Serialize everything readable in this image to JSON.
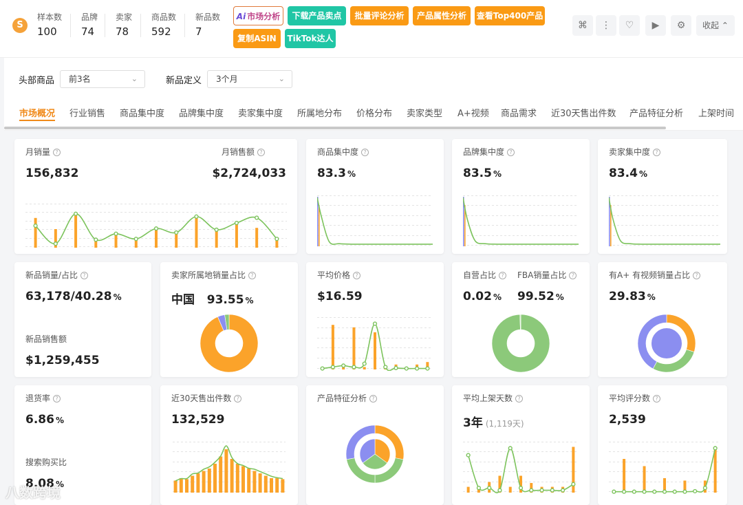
{
  "header": {
    "logo_glyph": "S",
    "stats": [
      {
        "label": "样本数",
        "value": "100"
      },
      {
        "label": "品牌",
        "value": "74"
      },
      {
        "label": "卖家",
        "value": "78"
      },
      {
        "label": "商品数",
        "value": "592"
      },
      {
        "label": "新品数",
        "value": "7"
      }
    ],
    "buttons": {
      "market_analysis_prefix": "Ai",
      "market_analysis": "市场分析",
      "download_selling_points": "下载产品卖点",
      "batch_review": "批量评论分析",
      "product_attribute": "产品属性分析",
      "top400": "查看Top400产品",
      "copy_asin": "复制ASIN",
      "tiktok": "TikTok达人"
    },
    "icons": [
      "grid-icon",
      "more-icon",
      "heart-icon",
      "play-icon",
      "settings-icon"
    ],
    "icon_glyphs": {
      "grid": "⌘",
      "more": "⋮",
      "heart": "♡",
      "play": "▶",
      "settings": "⚙"
    },
    "collapse_label": "收起",
    "collapse_glyph": "⌃"
  },
  "filters": {
    "top_label": "头部商品",
    "top_value": "前3名",
    "new_label": "新品定义",
    "new_value": "3个月",
    "chevron": "⌄"
  },
  "tabs": [
    "市场概况",
    "行业销售",
    "商品集中度",
    "品牌集中度",
    "卖家集中度",
    "所属地分布",
    "价格分布",
    "卖家类型",
    "A+视频",
    "商品需求",
    "近30天售出件数",
    "产品特征分析",
    "上架时间"
  ],
  "active_tab": 0,
  "cards": {
    "monthly_sales": {
      "title": "月销量",
      "value": "156,832",
      "title2": "月销售额",
      "value2": "$2,724,033"
    },
    "product_conc": {
      "title": "商品集中度",
      "value": "83.3",
      "pct": "%"
    },
    "brand_conc": {
      "title": "品牌集中度",
      "value": "83.5",
      "pct": "%"
    },
    "seller_conc": {
      "title": "卖家集中度",
      "value": "83.4",
      "pct": "%"
    },
    "new_sales": {
      "title": "新品销量/占比",
      "value": "63,178/40.28",
      "pct": "%",
      "title2": "新品销售额",
      "value2": "$1,259,455"
    },
    "seller_region": {
      "title": "卖家所属地销量占比",
      "region": "中国",
      "value": "93.55",
      "pct": "%"
    },
    "avg_price": {
      "title": "平均价格",
      "value": "$16.59"
    },
    "self_fba": {
      "title": "自营占比",
      "value": "0.02",
      "pct": "%",
      "title2": "FBA销量占比",
      "value2": "99.52",
      "pct2": "%"
    },
    "aplus_video": {
      "title": "有A+ 有视频销量占比",
      "value": "29.83",
      "pct": "%"
    },
    "return_rate": {
      "title": "退货率",
      "value": "6.86",
      "pct": "%",
      "title2": "搜索购买比",
      "value2": "8.08",
      "pct2": "%"
    },
    "sold_30d": {
      "title": "近30天售出件数",
      "value": "132,529"
    },
    "product_features": {
      "title": "产品特征分析"
    },
    "avg_days": {
      "title": "平均上架天数",
      "value": "3年",
      "sub": "(1,119天)"
    },
    "avg_rating": {
      "title": "平均评分数",
      "value": "2,539"
    }
  },
  "chart_data": [
    {
      "type": "bar",
      "name": "monthly-sales",
      "values": [
        0.72,
        0.45,
        0.85,
        0.2,
        0.35,
        0.22,
        0.48,
        0.38,
        0.78,
        0.45,
        0.62,
        0.48,
        0.22
      ],
      "line": [
        0.55,
        0.1,
        0.85,
        0.2,
        0.35,
        0.22,
        0.48,
        0.38,
        0.78,
        0.45,
        0.62,
        0.75,
        0.22
      ]
    },
    {
      "type": "line",
      "name": "product-concentration",
      "values": [
        1.0,
        0.6,
        0.08,
        0.04,
        0.03,
        0.03,
        0.03,
        0.03,
        0.03,
        0.03
      ]
    },
    {
      "type": "line",
      "name": "brand-concentration",
      "values": [
        1.0,
        0.55,
        0.1,
        0.04,
        0.03,
        0.03,
        0.03,
        0.03,
        0.03,
        0.03
      ]
    },
    {
      "type": "line",
      "name": "seller-concentration",
      "values": [
        1.0,
        0.55,
        0.1,
        0.04,
        0.03,
        0.03,
        0.03,
        0.03,
        0.03,
        0.03
      ]
    },
    {
      "type": "pie",
      "name": "seller-region",
      "values": [
        93.55,
        4.0,
        2.45
      ],
      "colors": [
        "#fba32a",
        "#8b8ef0",
        "#8cc97a"
      ]
    },
    {
      "type": "bar",
      "name": "avg-price",
      "values": [
        0.05,
        0.9,
        0.05,
        0.85,
        0.05,
        0.75,
        0.05,
        0.1,
        0.05,
        0.1,
        0.15
      ],
      "line": [
        0.02,
        0.05,
        0.08,
        0.05,
        0.12,
        0.95,
        0.05,
        0.03,
        0.02,
        0.02,
        0.02
      ]
    },
    {
      "type": "pie",
      "name": "self-fba",
      "values": [
        99.52,
        0.48
      ],
      "colors": [
        "#8cc97a",
        "#cfe8c2"
      ]
    },
    {
      "type": "pie",
      "name": "aplus-video",
      "values": [
        29.83,
        28,
        42.17
      ],
      "colors": [
        "#fba32a",
        "#8cc97a",
        "#8b8ef0"
      ],
      "inner": [
        100
      ],
      "inner_colors": [
        "#8b8ef0"
      ]
    },
    {
      "type": "bar",
      "name": "sold-30d",
      "values": [
        0.25,
        0.3,
        0.28,
        0.35,
        0.4,
        0.45,
        0.5,
        0.6,
        0.75,
        0.9,
        0.7,
        0.6,
        0.55,
        0.5,
        0.45,
        0.4,
        0.35,
        0.3,
        0.3,
        0.28
      ],
      "line": [
        0.25,
        0.3,
        0.3,
        0.4,
        0.42,
        0.5,
        0.55,
        0.65,
        0.78,
        1.0,
        0.75,
        0.62,
        0.58,
        0.52,
        0.5,
        0.45,
        0.4,
        0.35,
        0.32,
        0.3
      ]
    },
    {
      "type": "pie",
      "name": "product-features",
      "values": [
        28,
        22,
        22,
        28
      ],
      "colors": [
        "#fba32a",
        "#8cc97a",
        "#8cc97a",
        "#8b8ef0"
      ],
      "inner": [
        35,
        30,
        35
      ],
      "inner_colors": [
        "#fba32a",
        "#8cc97a",
        "#8b8ef0"
      ]
    },
    {
      "type": "bar",
      "name": "avg-days",
      "values": [
        0.12,
        0.12,
        0.22,
        0.35,
        0.12,
        0.35,
        0.2,
        0.12,
        0.12,
        0.12,
        0.95
      ],
      "line": [
        0.8,
        0.1,
        0.1,
        0.05,
        0.95,
        0.1,
        0.05,
        0.05,
        0.05,
        0.05,
        0.18
      ]
    },
    {
      "type": "bar",
      "name": "avg-rating",
      "values": [
        0.05,
        0.7,
        0.05,
        0.55,
        0.05,
        0.3,
        0.05,
        0.25,
        0.05,
        0.25,
        0.9
      ],
      "line": [
        0.02,
        0.02,
        0.02,
        0.02,
        0.02,
        0.02,
        0.02,
        0.02,
        0.03,
        0.1,
        0.95
      ]
    }
  ],
  "colors": {
    "orange": "#fba32a",
    "green": "#7cc35c",
    "purple": "#8b8ef0",
    "accent": "#f08a1a"
  },
  "watermark": "八数跨境"
}
